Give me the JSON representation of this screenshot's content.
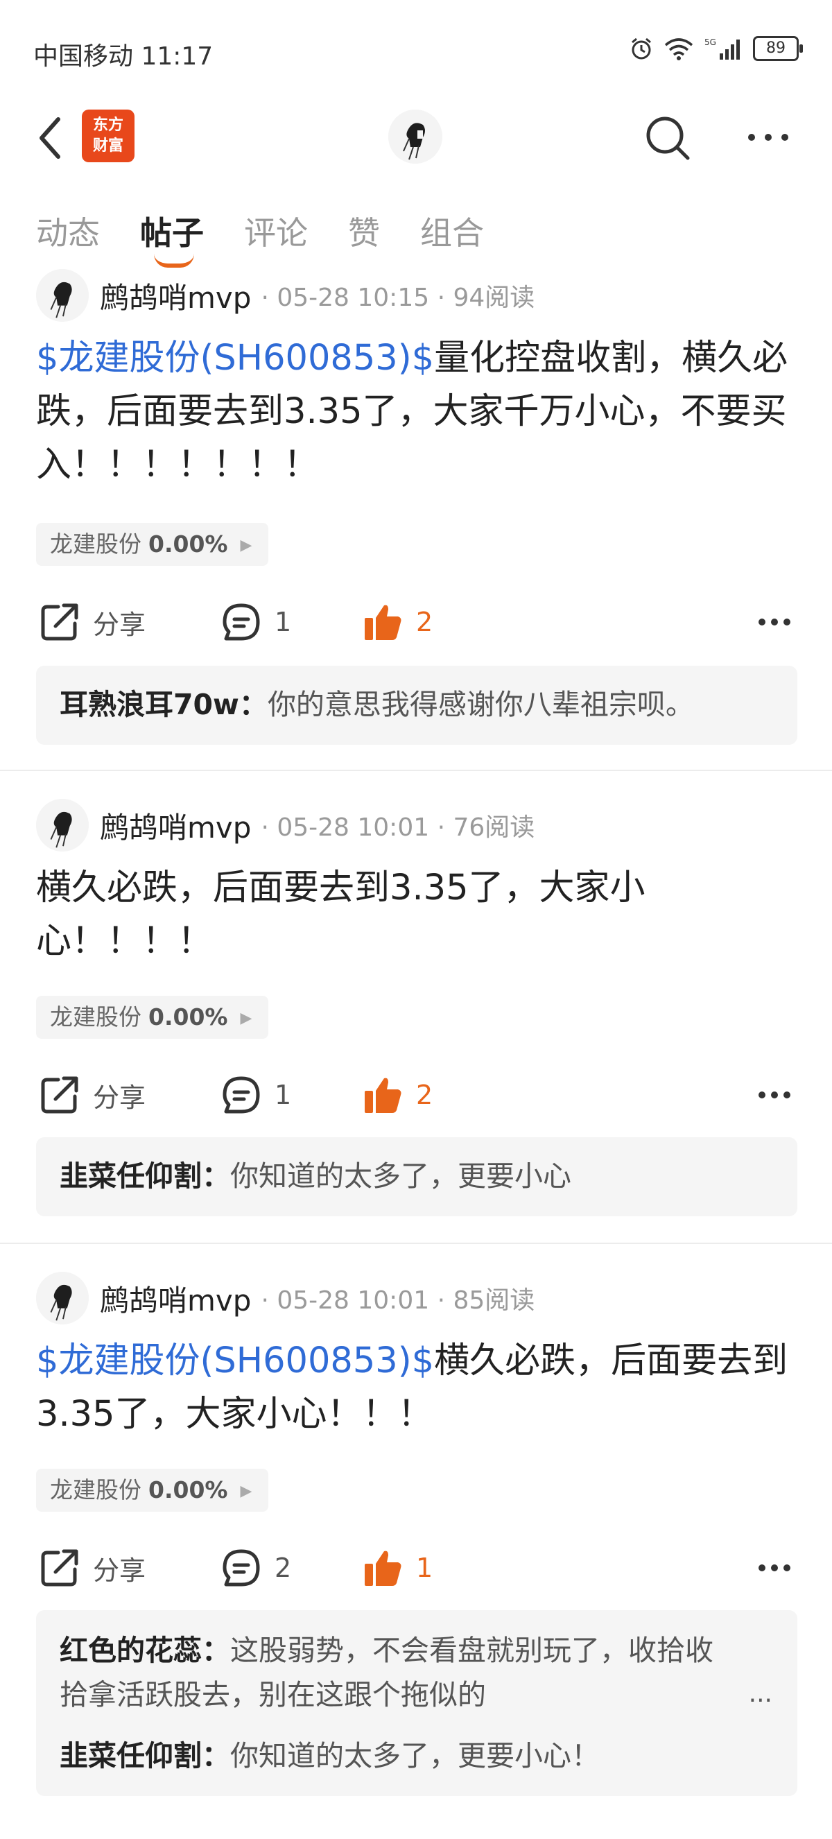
{
  "status_bar": {
    "carrier": "中国移动 11:17",
    "network": "5G",
    "wifi_level": "6",
    "battery": "89"
  },
  "header": {
    "logo_line1": "东方",
    "logo_line2": "财富"
  },
  "tabs": [
    "动态",
    "帖子",
    "评论",
    "赞",
    "组合"
  ],
  "active_tab": "帖子",
  "colors": {
    "accent": "#e8651a",
    "stock_link": "#2f6bd6",
    "logo_bg": "#e8481b"
  },
  "posts": [
    {
      "author": "鹧鸪哨mvp",
      "meta": "· 05-28 10:15 · 94阅读",
      "stock_link": "$龙建股份(SH600853)$",
      "text": "量化控盘收割，横久必跌，后面要去到3.35了，大家千万小心，不要买入！！！！！！！",
      "tag_name": "龙建股份",
      "tag_value": "0.00%",
      "share_label": "分享",
      "comment_count": "1",
      "like_count": "2",
      "comments": [
        {
          "who": "耳熟浪耳70w：",
          "text": "你的意思我得感谢你八辈祖宗呗。"
        }
      ]
    },
    {
      "author": "鹧鸪哨mvp",
      "meta": "· 05-28 10:01 · 76阅读",
      "stock_link": "",
      "text": "横久必跌，后面要去到3.35了，大家小心！！！！",
      "tag_name": "龙建股份",
      "tag_value": "0.00%",
      "share_label": "分享",
      "comment_count": "1",
      "like_count": "2",
      "comments": [
        {
          "who": "韭菜任仰割：",
          "text": "你知道的太多了，更要小心"
        }
      ]
    },
    {
      "author": "鹧鸪哨mvp",
      "meta": "· 05-28 10:01 · 85阅读",
      "stock_link": "$龙建股份(SH600853)$",
      "text": "横久必跌，后面要去到3.35了，大家小心！！！",
      "tag_name": "龙建股份",
      "tag_value": "0.00%",
      "share_label": "分享",
      "comment_count": "2",
      "like_count": "1",
      "comments": [
        {
          "who": "红色的花蕊：",
          "text": "这股弱势，不会看盘就别玩了，收拾收拾拿活跃股去，别在这跟个拖似的"
        },
        {
          "who": "韭菜任仰割：",
          "text": "你知道的太多了，更要小心！"
        }
      ],
      "more_indicator": "..."
    }
  ]
}
